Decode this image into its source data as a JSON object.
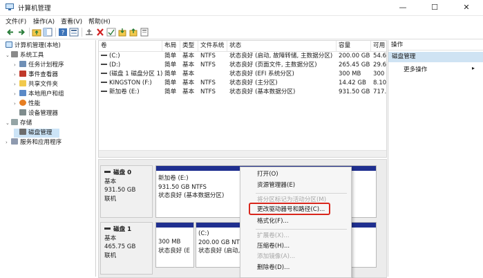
{
  "window": {
    "title": "计算机管理",
    "controls": {
      "minimize": "—",
      "maximize": "☐",
      "close": "✕"
    }
  },
  "menu": [
    "文件(F)",
    "操作(A)",
    "查看(V)",
    "帮助(H)"
  ],
  "toolbar_icons": [
    "back-arrow-icon",
    "forward-arrow-icon",
    "up-folder-icon",
    "show-tree-icon",
    "help-icon",
    "properties-icon",
    "connect-icon",
    "delete-icon",
    "check-icon",
    "import-icon",
    "export-icon",
    "help-book-icon"
  ],
  "tree": {
    "root": "计算机管理(本地)",
    "system_tools": "系统工具",
    "task_scheduler": "任务计划程序",
    "event_viewer": "事件查看器",
    "shared_folders": "共享文件夹",
    "local_users": "本地用户和组",
    "performance": "性能",
    "device_manager": "设备管理器",
    "storage": "存储",
    "disk_management": "磁盘管理",
    "services_apps": "服务和应用程序"
  },
  "volumes": {
    "headers": [
      "卷",
      "布局",
      "类型",
      "文件系统",
      "状态",
      "容量",
      "可用"
    ],
    "rows": [
      [
        "(C:)",
        "简单",
        "基本",
        "NTFS",
        "状态良好 (启动, 故障转储, 主数据分区)",
        "200.00 GB",
        "54.6"
      ],
      [
        "(D:)",
        "简单",
        "基本",
        "NTFS",
        "状态良好 (页面文件, 主数据分区)",
        "265.45 GB",
        "29.6"
      ],
      [
        "(磁盘 1 磁盘分区 1)",
        "简单",
        "基本",
        "",
        "状态良好 (EFI 系统分区)",
        "300 MB",
        "300"
      ],
      [
        "KINGSTON (F:)",
        "简单",
        "基本",
        "NTFS",
        "状态良好 (主分区)",
        "14.42 GB",
        "8.10"
      ],
      [
        "新加卷 (E:)",
        "简单",
        "基本",
        "NTFS",
        "状态良好 (基本数据分区)",
        "931.50 GB",
        "717."
      ]
    ]
  },
  "disks": [
    {
      "name": "磁盘 0",
      "type": "基本",
      "size": "931.50 GB",
      "status": "联机",
      "partitions": [
        {
          "label": "新加卷  (E:)",
          "size": "931.50 GB NTFS",
          "status": "状态良好 (基本数据分区)"
        }
      ]
    },
    {
      "name": "磁盘 1",
      "type": "基本",
      "size": "465.75 GB",
      "status": "联机",
      "partitions": [
        {
          "label": "",
          "size": "300 MB",
          "status": "状态良好 (E"
        },
        {
          "label": "(C:)",
          "size": "200.00 GB NTFS",
          "status": "状态良好 (启动, 故"
        }
      ]
    }
  ],
  "actions": {
    "header": "操作",
    "section": "磁盘管理",
    "more": "更多操作",
    "arrow": "▸"
  },
  "context_menu": [
    {
      "label": "打开(O)",
      "enabled": true
    },
    {
      "label": "资源管理器(E)",
      "enabled": true
    },
    {
      "label": "将分区标记为活动分区(M)",
      "enabled": false
    },
    {
      "label": "更改驱动器号和路径(C)...",
      "enabled": true
    },
    {
      "label": "格式化(F)...",
      "enabled": true
    },
    {
      "label": "扩展卷(X)...",
      "enabled": false
    },
    {
      "label": "压缩卷(H)...",
      "enabled": true
    },
    {
      "label": "添加镜像(A)...",
      "enabled": false
    },
    {
      "label": "删除卷(D)...",
      "enabled": true
    }
  ],
  "colors": {
    "partition_bar": "#1f2f8f",
    "selection": "#cce4f7",
    "highlight_box": "#d9261c"
  }
}
